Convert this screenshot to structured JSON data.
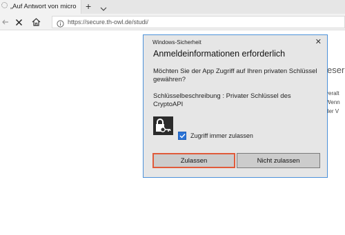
{
  "browser": {
    "tab_title": "„Auf Antwort von micro",
    "tab_close": "✕",
    "new_tab": "+",
    "address_url": "https://secure.th-owl.de/studi/"
  },
  "background": {
    "heading_fragment": "eser",
    "lines": [
      "veralt",
      "Wenn",
      "der V"
    ]
  },
  "dialog": {
    "caption": "Windows-Sicherheit",
    "close": "✕",
    "title": "Anmeldeinformationen erforderlich",
    "message": "Möchten Sie der App Zugriff auf Ihren privaten Schlüssel gewähren?",
    "key_description": "Schlüsselbeschreibung  : Privater Schlüssel des CryptoAPI",
    "checkbox_label": "Zugriff immer zulassen",
    "checkbox_checked": true,
    "allow_label": "Zulassen",
    "deny_label": "Nicht zulassen",
    "accent_color": "#2b73d6",
    "focus_color": "#e05a3a"
  }
}
